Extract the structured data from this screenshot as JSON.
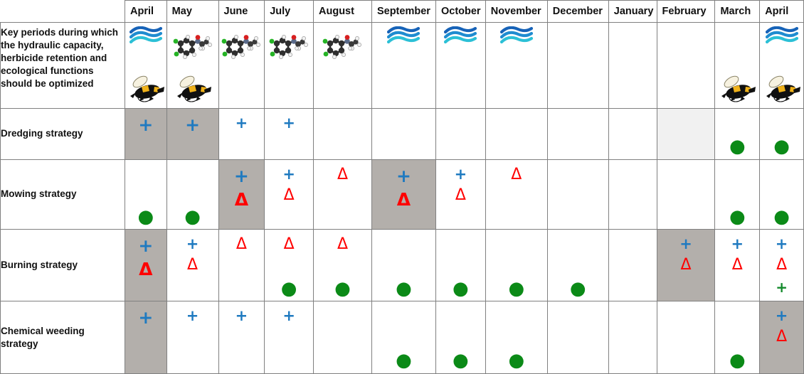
{
  "table": {
    "corner_label": "",
    "months": [
      "April",
      "May",
      "June",
      "July",
      "August",
      "September",
      "October",
      "November",
      "December",
      "January",
      "February",
      "March",
      "April"
    ],
    "rows": [
      {
        "label": "Key periods during which the hydraulic capacity, herbicide retention and ecological functions should be optimized",
        "key": "key_periods",
        "cells": [
          {
            "month": "April",
            "shade": "none",
            "icons": [
              "wave-icon",
              "bee-icon"
            ]
          },
          {
            "month": "May",
            "shade": "none",
            "icons": [
              "molecule-icon",
              "bee-icon"
            ]
          },
          {
            "month": "June",
            "shade": "none",
            "icons": [
              "molecule-icon"
            ]
          },
          {
            "month": "July",
            "shade": "none",
            "icons": [
              "molecule-icon"
            ]
          },
          {
            "month": "August",
            "shade": "none",
            "icons": [
              "molecule-icon"
            ]
          },
          {
            "month": "September",
            "shade": "none",
            "icons": [
              "wave-icon"
            ]
          },
          {
            "month": "October",
            "shade": "none",
            "icons": [
              "wave-icon"
            ]
          },
          {
            "month": "November",
            "shade": "none",
            "icons": [
              "wave-icon"
            ]
          },
          {
            "month": "December",
            "shade": "none",
            "icons": []
          },
          {
            "month": "January",
            "shade": "none",
            "icons": []
          },
          {
            "month": "February",
            "shade": "none",
            "icons": []
          },
          {
            "month": "March",
            "shade": "none",
            "icons": [
              "bee-icon"
            ]
          },
          {
            "month": "April",
            "shade": "none",
            "icons": [
              "wave-icon",
              "bee-icon"
            ]
          }
        ]
      },
      {
        "label": "Dredging strategy",
        "key": "dredging",
        "cells": [
          {
            "month": "April",
            "shade": "dark",
            "symbols": [
              "blue-plus-bold"
            ]
          },
          {
            "month": "May",
            "shade": "dark",
            "symbols": [
              "blue-plus-bold"
            ]
          },
          {
            "month": "June",
            "shade": "none",
            "symbols": [
              "blue-plus"
            ]
          },
          {
            "month": "July",
            "shade": "none",
            "symbols": [
              "blue-plus"
            ]
          },
          {
            "month": "August",
            "shade": "none",
            "symbols": []
          },
          {
            "month": "September",
            "shade": "none",
            "symbols": []
          },
          {
            "month": "October",
            "shade": "none",
            "symbols": []
          },
          {
            "month": "November",
            "shade": "none",
            "symbols": []
          },
          {
            "month": "December",
            "shade": "none",
            "symbols": []
          },
          {
            "month": "January",
            "shade": "none",
            "symbols": []
          },
          {
            "month": "February",
            "shade": "light",
            "symbols": []
          },
          {
            "month": "March",
            "shade": "none",
            "symbols": [
              "green-dot"
            ]
          },
          {
            "month": "April",
            "shade": "none",
            "symbols": [
              "green-dot"
            ]
          }
        ]
      },
      {
        "label": "Mowing strategy",
        "key": "mowing",
        "cells": [
          {
            "month": "April",
            "shade": "none",
            "symbols": [
              "green-dot"
            ]
          },
          {
            "month": "May",
            "shade": "none",
            "symbols": [
              "green-dot"
            ]
          },
          {
            "month": "June",
            "shade": "dark",
            "symbols": [
              "blue-plus-bold",
              "red-triangle-bold"
            ]
          },
          {
            "month": "July",
            "shade": "none",
            "symbols": [
              "blue-plus",
              "red-triangle"
            ]
          },
          {
            "month": "August",
            "shade": "none",
            "symbols": [
              "red-triangle"
            ]
          },
          {
            "month": "September",
            "shade": "dark",
            "symbols": [
              "blue-plus-bold",
              "red-triangle-bold"
            ]
          },
          {
            "month": "October",
            "shade": "none",
            "symbols": [
              "blue-plus",
              "red-triangle"
            ]
          },
          {
            "month": "November",
            "shade": "none",
            "symbols": [
              "red-triangle"
            ]
          },
          {
            "month": "December",
            "shade": "none",
            "symbols": []
          },
          {
            "month": "January",
            "shade": "none",
            "symbols": []
          },
          {
            "month": "February",
            "shade": "none",
            "symbols": []
          },
          {
            "month": "March",
            "shade": "none",
            "symbols": [
              "green-dot"
            ]
          },
          {
            "month": "April",
            "shade": "none",
            "symbols": [
              "green-dot"
            ]
          }
        ]
      },
      {
        "label": "Burning strategy",
        "key": "burning",
        "cells": [
          {
            "month": "April",
            "shade": "dark",
            "symbols": [
              "blue-plus-bold",
              "red-triangle-bold"
            ]
          },
          {
            "month": "May",
            "shade": "none",
            "symbols": [
              "blue-plus",
              "red-triangle"
            ]
          },
          {
            "month": "June",
            "shade": "none",
            "symbols": [
              "red-triangle"
            ]
          },
          {
            "month": "July",
            "shade": "none",
            "symbols": [
              "red-triangle",
              "green-dot"
            ]
          },
          {
            "month": "August",
            "shade": "none",
            "symbols": [
              "red-triangle",
              "green-dot"
            ]
          },
          {
            "month": "September",
            "shade": "none",
            "symbols": [
              "green-dot"
            ]
          },
          {
            "month": "October",
            "shade": "none",
            "symbols": [
              "green-dot"
            ]
          },
          {
            "month": "November",
            "shade": "none",
            "symbols": [
              "green-dot"
            ]
          },
          {
            "month": "December",
            "shade": "none",
            "symbols": [
              "green-dot"
            ]
          },
          {
            "month": "January",
            "shade": "none",
            "symbols": []
          },
          {
            "month": "February",
            "shade": "dark",
            "symbols": [
              "blue-plus",
              "red-triangle"
            ]
          },
          {
            "month": "March",
            "shade": "none",
            "symbols": [
              "blue-plus",
              "red-triangle"
            ]
          },
          {
            "month": "April",
            "shade": "none",
            "symbols": [
              "blue-plus",
              "red-triangle",
              "green-plus"
            ]
          }
        ]
      },
      {
        "label": "Chemical weeding strategy",
        "key": "chemical_weeding",
        "cells": [
          {
            "month": "April",
            "shade": "dark",
            "symbols": [
              "blue-plus-bold"
            ]
          },
          {
            "month": "May",
            "shade": "none",
            "symbols": [
              "blue-plus"
            ]
          },
          {
            "month": "June",
            "shade": "none",
            "symbols": [
              "blue-plus"
            ]
          },
          {
            "month": "July",
            "shade": "none",
            "symbols": [
              "blue-plus"
            ]
          },
          {
            "month": "August",
            "shade": "none",
            "symbols": []
          },
          {
            "month": "September",
            "shade": "none",
            "symbols": [
              "green-dot"
            ]
          },
          {
            "month": "October",
            "shade": "none",
            "symbols": [
              "green-dot"
            ]
          },
          {
            "month": "November",
            "shade": "none",
            "symbols": [
              "green-dot"
            ]
          },
          {
            "month": "December",
            "shade": "none",
            "symbols": []
          },
          {
            "month": "January",
            "shade": "none",
            "symbols": []
          },
          {
            "month": "February",
            "shade": "none",
            "symbols": []
          },
          {
            "month": "March",
            "shade": "none",
            "symbols": [
              "green-dot"
            ]
          },
          {
            "month": "April",
            "shade": "dark",
            "symbols": [
              "blue-plus",
              "red-triangle"
            ]
          }
        ]
      }
    ]
  },
  "symbols": {
    "blue-plus": "+",
    "blue-plus-bold": "+",
    "red-triangle": "Δ",
    "red-triangle-bold": "Δ",
    "green-dot": "●",
    "green-plus": "+"
  },
  "colors": {
    "blue_plus": "#1f7ac0",
    "red_triangle": "#ff0000",
    "green_dot": "#0b8a17",
    "green_plus": "#12892a",
    "shade_dark": "#b3afab",
    "shade_light": "#f1f1f1",
    "grid_line": "#808080",
    "text": "#111111"
  }
}
